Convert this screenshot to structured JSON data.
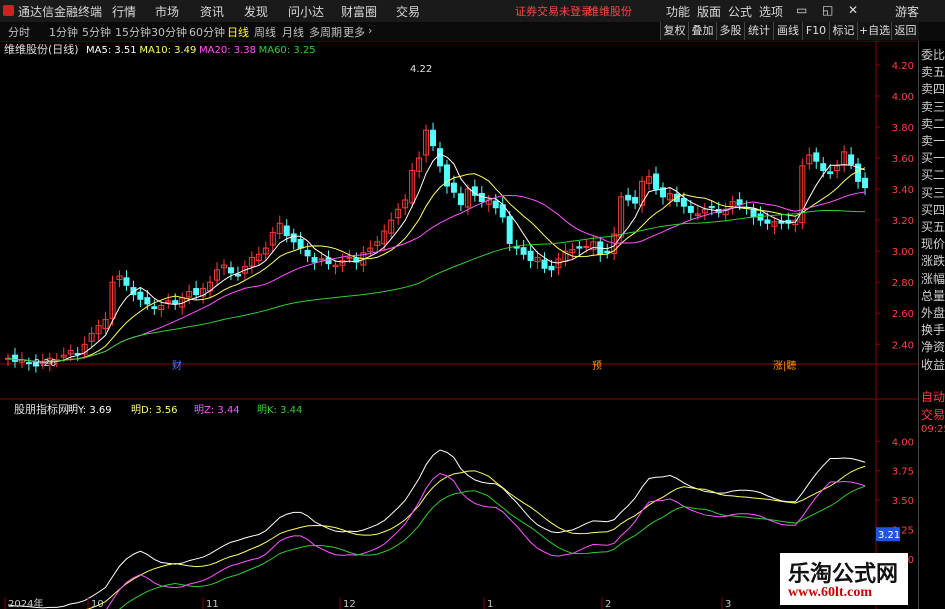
{
  "app": {
    "title": "通达信金融终端",
    "menus": [
      "行情",
      "市场",
      "资讯",
      "发现",
      "问小达",
      "财富圈",
      "交易"
    ],
    "notice": "证券交易未登录",
    "stock_name": "维维股份",
    "right_menus": [
      "功能",
      "版面",
      "公式",
      "选项"
    ],
    "user": "游客"
  },
  "toolbar": {
    "periods": [
      "分时",
      "1分钟",
      "5分钟",
      "15分钟",
      "30分钟",
      "60分钟",
      "日线",
      "周线",
      "月线",
      "多周期",
      "更多"
    ],
    "active": "日线",
    "right_buttons": [
      "复权",
      "叠加",
      "多股",
      "统计",
      "画线",
      "F10",
      "标记",
      "+自选",
      "返回"
    ]
  },
  "sidebar": {
    "items": [
      "委比",
      "卖五",
      "卖四",
      "卖三",
      "卖二",
      "卖一",
      "买一",
      "买二",
      "买三",
      "买四",
      "买五",
      "现价",
      "涨跌",
      "涨幅",
      "总量",
      "外盘",
      "换手",
      "净资",
      "收益",
      "自动",
      "交易",
      "09:25"
    ]
  },
  "markers": [
    "财",
    "预",
    "涨|聽"
  ],
  "watermark": {
    "line1": "乐淘公式网",
    "line2": "www.60lt.com"
  },
  "colors": {
    "up": "#ff3b3b",
    "down": "#54ffff",
    "ma5": "#ffffff",
    "ma10": "#ffff66",
    "ma20": "#ff55ff",
    "ma60": "#33cc33",
    "accent": "#ff3b3b"
  },
  "chart_data": [
    {
      "type": "candlestick",
      "title": "维维股份(日线)",
      "legend": [
        {
          "name": "MA5",
          "value": "3.51"
        },
        {
          "name": "MA10",
          "value": "3.49"
        },
        {
          "name": "MA20",
          "value": "3.38"
        },
        {
          "name": "MA60",
          "value": "3.25"
        }
      ],
      "y_ticks": [
        4.2,
        4.0,
        3.8,
        3.6,
        3.4,
        3.2,
        3.0,
        2.8,
        2.6,
        2.4
      ],
      "ylim": [
        2.26,
        4.29
      ],
      "annotations": [
        {
          "text": "4.22",
          "value": 4.22
        },
        {
          "text": "2.26",
          "value": 2.26
        }
      ],
      "x_labels": [
        "2024年",
        "10",
        "11",
        "12",
        "1",
        "2",
        "3"
      ],
      "close": [
        2.31,
        2.29,
        2.3,
        2.28,
        2.26,
        2.29,
        2.31,
        2.3,
        2.33,
        2.36,
        2.34,
        2.4,
        2.47,
        2.52,
        2.56,
        2.8,
        2.84,
        2.78,
        2.72,
        2.69,
        2.66,
        2.63,
        2.65,
        2.68,
        2.66,
        2.7,
        2.74,
        2.72,
        2.76,
        2.8,
        2.88,
        2.91,
        2.86,
        2.84,
        2.9,
        2.96,
        2.98,
        3.02,
        3.12,
        3.18,
        3.1,
        3.06,
        3.02,
        2.97,
        2.93,
        2.95,
        2.92,
        2.91,
        2.94,
        2.96,
        2.93,
        2.99,
        3.02,
        3.06,
        3.13,
        3.2,
        3.27,
        3.33,
        3.52,
        3.6,
        3.78,
        3.68,
        3.55,
        3.42,
        3.38,
        3.3,
        3.4,
        3.36,
        3.32,
        3.33,
        3.28,
        3.22,
        3.05,
        3.02,
        2.98,
        2.94,
        2.96,
        2.89,
        2.88,
        2.95,
        3.0,
        3.01,
        3.02,
        3.03,
        3.06,
        2.98,
        2.99,
        3.11,
        3.35,
        3.33,
        3.31,
        3.45,
        3.48,
        3.4,
        3.35,
        3.37,
        3.32,
        3.29,
        3.25,
        3.24,
        3.27,
        3.28,
        3.25,
        3.27,
        3.32,
        3.3,
        3.28,
        3.22,
        3.2,
        3.18,
        3.19,
        3.18,
        3.18,
        3.2,
        3.55,
        3.62,
        3.58,
        3.52,
        3.5,
        3.55,
        3.64,
        3.56,
        3.45,
        3.41
      ]
    },
    {
      "type": "line",
      "title": "股朋指标网",
      "legend": [
        {
          "name": "明Y",
          "value": "3.69"
        },
        {
          "name": "明D",
          "value": "3.56"
        },
        {
          "name": "明Z",
          "value": "3.44"
        },
        {
          "name": "明K",
          "value": "3.44"
        }
      ],
      "y_ticks": [
        4.0,
        3.75,
        3.5,
        3.25,
        3.0
      ],
      "ylim": [
        2.6,
        4.3
      ],
      "current_value": "3.21"
    }
  ]
}
